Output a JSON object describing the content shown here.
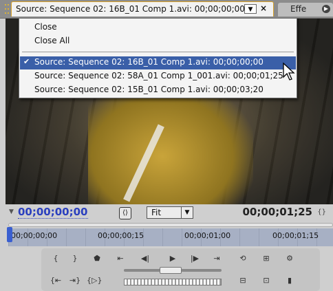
{
  "source_tab": {
    "label": "Source: Sequence 02: 16B_01 Comp 1.avi: 00;00;00;00",
    "dropdown_icon": "▼",
    "close_icon": "×"
  },
  "effects_tab": {
    "label": "Effe",
    "menu_icon": "▶"
  },
  "menu": {
    "items": [
      {
        "label": "Close"
      },
      {
        "label": "Close All"
      }
    ],
    "clips": [
      {
        "label": "Source: Sequence 02: 16B_01 Comp 1.avi: 00;00;00;00",
        "selected": true
      },
      {
        "label": "Source: Sequence 02: 58A_01 Comp 1_001.avi: 00;00;01;25",
        "selected": false
      },
      {
        "label": "Source: Sequence 02: 15B_01 Comp 1.avi: 00;00;03;20",
        "selected": false
      }
    ],
    "check_glyph": "✔"
  },
  "timecode": {
    "current": "00;00;00;00",
    "duration": "00;00;01;25",
    "zoom": "Fit",
    "zoom_arrow": "▼"
  },
  "ruler": {
    "labels": [
      "00;00;00;00",
      "00;00;00;15",
      "00;00;01;00",
      "00;00;01;15"
    ]
  },
  "colors": {
    "accent": "#d8a22a",
    "selection": "#3a5fa8",
    "timecode_blue": "#2a3fbf"
  }
}
